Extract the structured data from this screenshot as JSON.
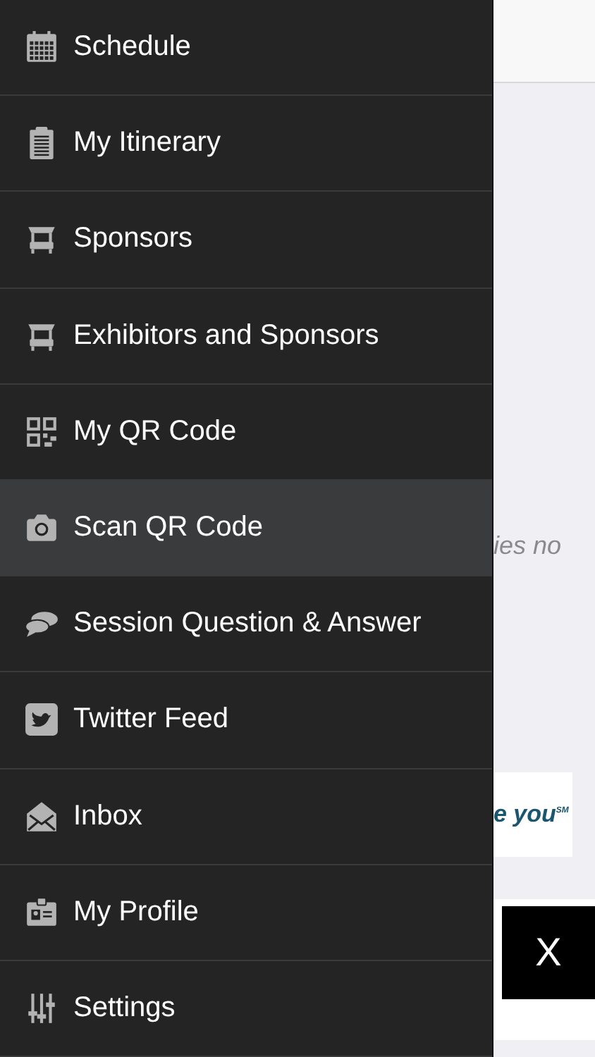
{
  "menu": [
    {
      "label": "Schedule",
      "kind": "calendar",
      "selected": false
    },
    {
      "label": "My Itinerary",
      "kind": "clipboard",
      "selected": false
    },
    {
      "label": "Sponsors",
      "kind": "booth",
      "selected": false
    },
    {
      "label": "Exhibitors and Sponsors",
      "kind": "booth",
      "selected": false
    },
    {
      "label": "My QR Code",
      "kind": "qr",
      "selected": false
    },
    {
      "label": "Scan QR Code",
      "kind": "camera",
      "selected": true
    },
    {
      "label": "Session Question & Answer",
      "kind": "chat",
      "selected": false
    },
    {
      "label": "Twitter Feed",
      "kind": "bird",
      "selected": false
    },
    {
      "label": "Inbox",
      "kind": "envelope",
      "selected": false
    },
    {
      "label": "My Profile",
      "kind": "badge",
      "selected": false
    },
    {
      "label": "Settings",
      "kind": "sliders",
      "selected": false
    }
  ],
  "content": {
    "text": "ies no",
    "banner": {
      "text": "e you",
      "mark": "SM"
    }
  },
  "close_button": "X"
}
